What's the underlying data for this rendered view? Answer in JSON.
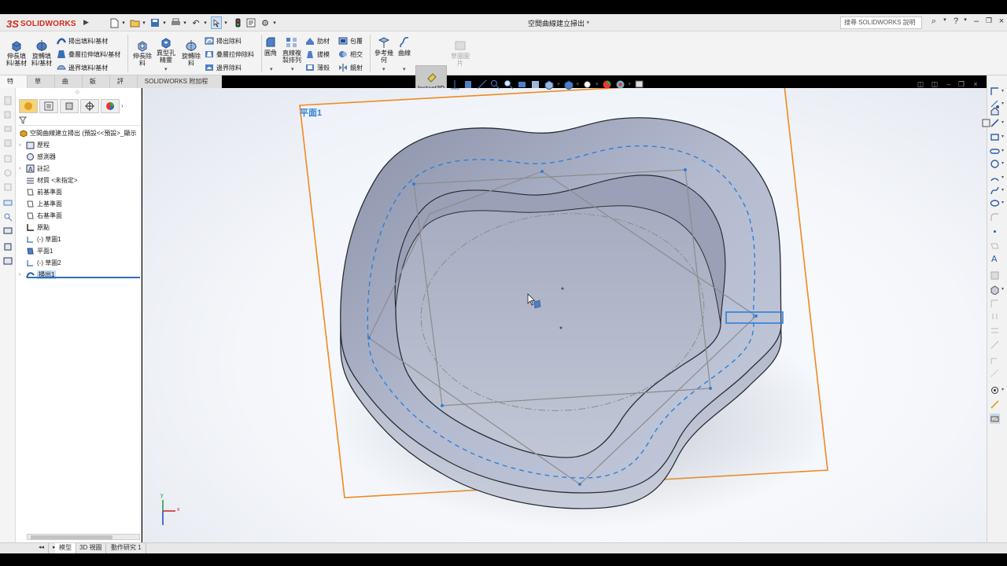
{
  "app": {
    "logo_mark": "3S",
    "logo_text": "SOLIDWORKS",
    "document_title": "空間曲線建立掃出 *",
    "search_placeholder": "搜尋 SOLIDWORKS 說明",
    "help_label": "?"
  },
  "commands": {
    "extrude_boss": "伸長填料/基材",
    "revolve_boss": "旋轉填料/基材",
    "swept_boss": "掃出填料/基材",
    "lofted_boss": "疊層拉伸填料/基材",
    "boundary_boss": "邊界填料/基材",
    "extrude_cut": "伸長除料",
    "hole_wizard": "異型孔精靈",
    "revolve_cut": "旋轉除料",
    "swept_cut": "掃出除料",
    "lofted_cut": "疊層拉伸除料",
    "boundary_cut": "邊界除料",
    "fillet": "圓角",
    "linear_pattern": "直線複製排列",
    "rib": "肋材",
    "draft": "拔模",
    "shell": "薄殼",
    "wrap": "包覆",
    "intersect": "相交",
    "mirror": "鏡射",
    "reference_geometry": "參考幾何",
    "curves": "曲線",
    "instant3d": "Instant3D",
    "section_view": "草圖圖片"
  },
  "tabs": [
    "特徵",
    "草圖",
    "曲面",
    "鈑金",
    "評估",
    "SOLIDWORKS 附加程式"
  ],
  "active_tab": 0,
  "tree": {
    "root": "空間曲線建立掃出 (預設<<預設>_顯示",
    "items": [
      {
        "label": "歷程",
        "expandable": true
      },
      {
        "label": "感測器",
        "expandable": false
      },
      {
        "label": "註記",
        "expandable": true
      },
      {
        "label": "材質 <未指定>",
        "expandable": false
      },
      {
        "label": "前基準面",
        "expandable": false
      },
      {
        "label": "上基準面",
        "expandable": false
      },
      {
        "label": "右基準面",
        "expandable": false
      },
      {
        "label": "原點",
        "expandable": false
      },
      {
        "label": "(-) 草圖1",
        "expandable": false
      },
      {
        "label": "平面1",
        "expandable": false
      },
      {
        "label": "(-) 草圖2",
        "expandable": false
      },
      {
        "label": "掃出1",
        "expandable": true
      }
    ],
    "selected_index": 11
  },
  "viewport": {
    "plane_label": "平面1",
    "triad_x": "x",
    "triad_y": "y",
    "plane_color": "#f08a1e",
    "body_color": "#8a93ad",
    "sketch_color": "#2e7fd9"
  },
  "bottom_tabs": [
    "模型",
    "3D 視圖",
    "動作研究 1"
  ],
  "active_bottom_tab": 0
}
